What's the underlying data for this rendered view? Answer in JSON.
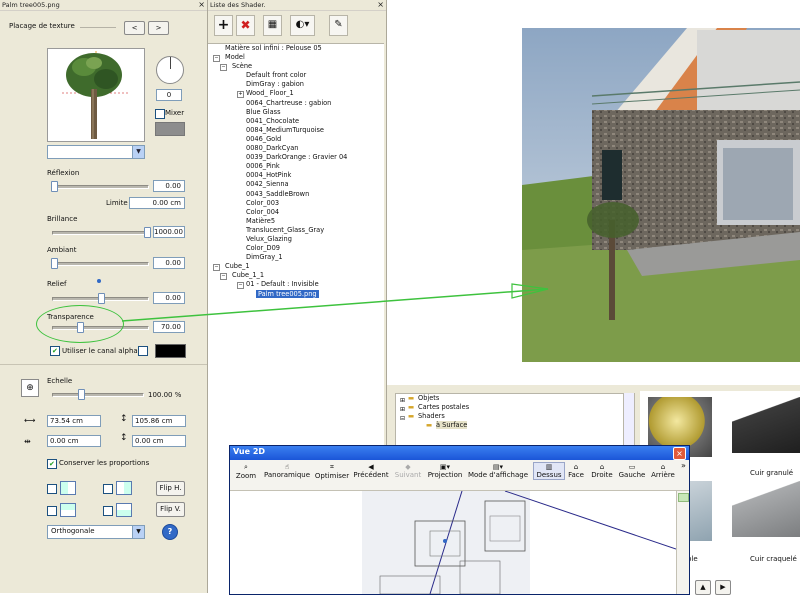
{
  "texture_panel": {
    "title": "Palm tree005.png",
    "placage_label": "Placage de texture",
    "nav_prev": "<",
    "nav_next": ">",
    "rotation_value": "0",
    "mixer_label": "Mixer",
    "reflexion_label": "Réflexion",
    "reflexion_value": "0.00",
    "limite_label": "Limite",
    "limite_value": "0.00 cm",
    "brillance_label": "Brillance",
    "brillance_value": "1000.00",
    "ambiant_label": "Ambiant",
    "ambiant_value": "0.00",
    "relief_label": "Relief",
    "relief_value": "0.00",
    "transparence_label": "Transparence",
    "transparence_value": "70.00",
    "alpha_label": "Utiliser le canal alpha",
    "echelle_label": "Echelle",
    "echelle_value": "100.00 %",
    "width_value": "73.54 cm",
    "height_value": "105.86 cm",
    "offset_x": "0.00 cm",
    "offset_y": "0.00 cm",
    "conserver_label": "Conserver les proportions",
    "flip_h": "Flip H.",
    "flip_v": "Flip V.",
    "projection_value": "Orthogonale",
    "help": "?"
  },
  "shader_list": {
    "title": "Liste des Shader.",
    "items": [
      "Matière sol infini : Pelouse 05",
      "Model",
      "Scène",
      "Default front color",
      "DimGray : gabion",
      "Wood_ Floor_1",
      "0064_Chartreuse : gabion",
      "Blue Glass",
      "0041_Chocolate",
      "0084_MediumTurquoise",
      "0046_Gold",
      "0080_DarkCyan",
      "0039_DarkOrange : Gravier 04",
      "0006_Pink",
      "0004_HotPink",
      "0042_Sienna",
      "0043_SaddleBrown",
      "Color_003",
      "Color_004",
      "Matière5",
      "Translucent_Glass_Gray",
      "Velux_Glazing",
      "Color_D09",
      "DimGray_1",
      "Cube_1",
      "Cube_1_1",
      "01 - Default : Invisible",
      "Palm tree005.png"
    ]
  },
  "library": {
    "items": [
      "Objets",
      "Cartes postales",
      "Shaders",
      "à Surface"
    ],
    "thumbs": [
      "Cuir granulé",
      "Cuir craquelé",
      "ble"
    ]
  },
  "vue2d": {
    "title": "Vue 2D",
    "tools": [
      "Zoom",
      "Panoramique",
      "Optimiser",
      "Précédent",
      "Suivant",
      "Projection",
      "Mode d'affichage",
      "Dessus",
      "Face",
      "Droite",
      "Gauche",
      "Arrière"
    ],
    "more": "»"
  },
  "colors": {
    "accent": "#3169c6",
    "annotation": "#3ec23e",
    "panel_bg": "#ece9d8"
  }
}
